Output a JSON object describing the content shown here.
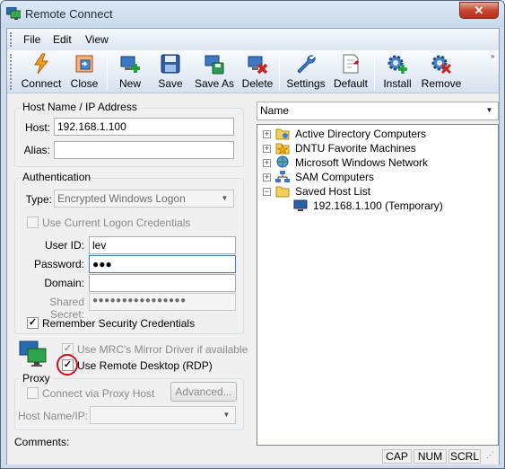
{
  "window": {
    "title": "Remote Connect",
    "close_glyph": "✕"
  },
  "menu": {
    "file": "File",
    "edit": "Edit",
    "view": "View"
  },
  "toolbar": {
    "connect": "Connect",
    "close": "Close",
    "new": "New",
    "save": "Save",
    "save_as": "Save As",
    "delete": "Delete",
    "settings": "Settings",
    "default": "Default",
    "install": "Install",
    "remove": "Remove",
    "chevron": "»"
  },
  "host_group": {
    "title": "Host Name / IP Address",
    "host_label": "Host:",
    "host_value": "192.168.1.100",
    "alias_label": "Alias:",
    "alias_value": ""
  },
  "auth_group": {
    "title": "Authentication",
    "type_label": "Type:",
    "type_value": "Encrypted Windows Logon",
    "use_current": "Use Current Logon Credentials",
    "use_current_checked": false,
    "userid_label": "User ID:",
    "userid_value": "lev",
    "password_label": "Password:",
    "password_value": "●●●",
    "domain_label": "Domain:",
    "domain_value": "",
    "secret_label": "Shared Secret:",
    "secret_value": "●●●●●●●●●●●●●●●●",
    "remember": "Remember Security Credentials",
    "remember_checked": true
  },
  "mirror": {
    "label": "Use MRC's Mirror Driver if available",
    "checked": true
  },
  "rdp": {
    "label": "Use Remote Desktop (RDP)",
    "checked": true
  },
  "proxy_group": {
    "title": "Proxy",
    "connect_via": "Connect via Proxy Host",
    "connect_via_checked": false,
    "advanced": "Advanced...",
    "hostip_label": "Host Name/IP:",
    "hostip_value": ""
  },
  "comments_label": "Comments:",
  "right_panel": {
    "sort_value": "Name",
    "tree": [
      {
        "label": "Active Directory Computers",
        "expander": "+"
      },
      {
        "label": "DNTU Favorite Machines",
        "expander": "+"
      },
      {
        "label": "Microsoft Windows Network",
        "expander": "+"
      },
      {
        "label": "SAM Computers",
        "expander": "+"
      },
      {
        "label": "Saved Host List",
        "expander": "−"
      },
      {
        "label": "192.168.1.100 (Temporary)"
      }
    ]
  },
  "statusbar": {
    "cap": "CAP",
    "num": "NUM",
    "scrl": "SCRL"
  },
  "colors": {
    "highlight_circle": "#d0101c",
    "accent": "#3c7fb1"
  }
}
